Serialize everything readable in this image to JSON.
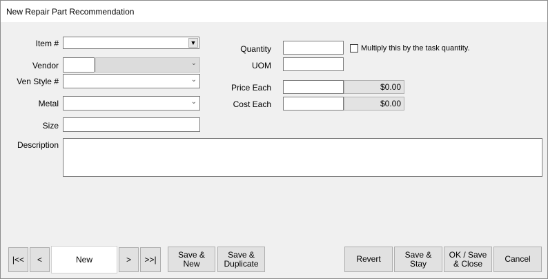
{
  "window": {
    "title": "New Repair Part Recommendation"
  },
  "fields": {
    "item_label": "Item #",
    "vendor_label": "Vendor",
    "ven_style_label": "Ven Style #",
    "metal_label": "Metal",
    "size_label": "Size",
    "description_label": "Description",
    "quantity_label": "Quantity",
    "multiply_label": "Multiply this by the task quantity.",
    "uom_label": "UOM",
    "price_each_label": "Price Each",
    "price_each_value": "$0.00",
    "cost_each_label": "Cost Each",
    "cost_each_value": "$0.00"
  },
  "nav": {
    "first": "|<<",
    "prev": "<",
    "record": "New",
    "next": ">",
    "last": ">>|"
  },
  "buttons": {
    "save_new_1": "Save &",
    "save_new_2": "New",
    "save_dup_1": "Save &",
    "save_dup_2": "Duplicate",
    "revert": "Revert",
    "save_stay_1": "Save &",
    "save_stay_2": "Stay",
    "ok_close_1": "OK / Save",
    "ok_close_2": "& Close",
    "cancel": "Cancel"
  },
  "icons": {
    "dropdown": "▼",
    "chevron": "⌄"
  }
}
